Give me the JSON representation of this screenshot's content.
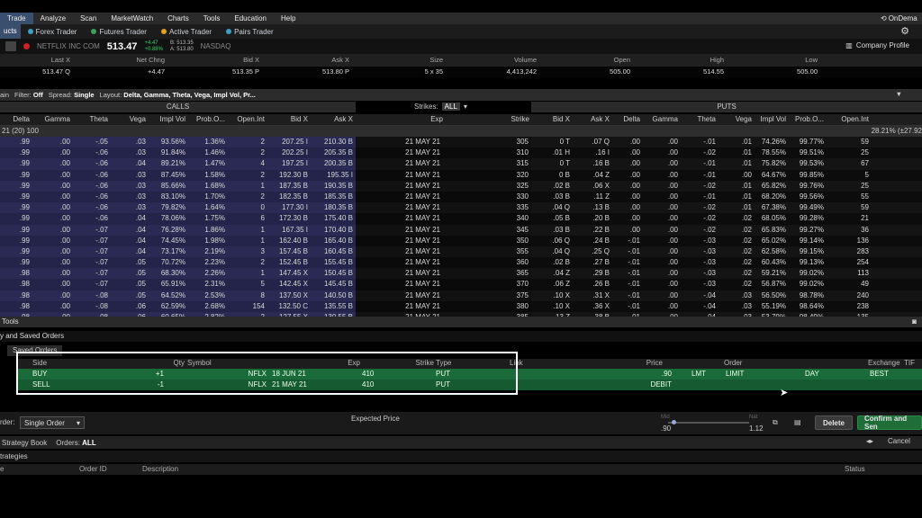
{
  "menu": [
    "Trade",
    "Analyze",
    "Scan",
    "MarketWatch",
    "Charts",
    "Tools",
    "Education",
    "Help"
  ],
  "menu_right": "OnDema",
  "toolbar": {
    "left_label": "ucts",
    "items": [
      {
        "label": "Forex Trader",
        "color": "#3aa0c9"
      },
      {
        "label": "Futures Trader",
        "color": "#3aa05a"
      },
      {
        "label": "Active Trader",
        "color": "#e0a020"
      },
      {
        "label": "Pairs Trader",
        "color": "#3aa0c9"
      }
    ]
  },
  "quote": {
    "name": "NETFLIX INC COM",
    "price": "513.47",
    "change": "+4.47",
    "change_pct": "+0.88%",
    "bid_line": "B: 513.35",
    "ask_line": "A: 513.80",
    "exchange": "NASDAQ",
    "profile": "Company Profile"
  },
  "summary": {
    "headers": [
      "Last X",
      "Net Chng",
      "Bid X",
      "Ask X",
      "Size",
      "Volume",
      "Open",
      "High",
      "Low"
    ],
    "values": [
      "513.47 Q",
      "+4.47",
      "513.35 P",
      "513.80 P",
      "5 x 35",
      "4,413,242",
      "505.00",
      "514.55",
      "505.00"
    ]
  },
  "chain_bar": {
    "prefix": "ain",
    "filter_label": "Filter:",
    "filter_value": "Off",
    "spread_label": "Spread:",
    "spread_value": "Single",
    "layout_label": "Layout:",
    "layout_value": "Delta, Gamma, Theta, Vega, Impl Vol, Pr..."
  },
  "calls_title": "CALLS",
  "puts_title": "PUTS",
  "strikes_label": "Strikes:",
  "strikes_value": "ALL",
  "call_cols": [
    "Delta",
    "Gamma",
    "Theta",
    "Vega",
    "Impl Vol",
    "Prob.O...",
    "Open.Int",
    "Bid X",
    "Ask X"
  ],
  "mid_cols": [
    "Exp",
    "Strike"
  ],
  "put_cols": [
    "Bid X",
    "Ask X",
    "Delta",
    "Gamma",
    "Theta",
    "Vega",
    "Impl Vol",
    "Prob.O...",
    "Open.Int"
  ],
  "group_row": {
    "left": "21   (20)   100",
    "right": "28.21% (±27.92"
  },
  "rows": [
    {
      "c": [
        ".99",
        ".00",
        "-.05",
        ".03",
        "93.56%",
        "1.36%",
        "2",
        "207.25  I",
        "210.30  B"
      ],
      "exp": "21 MAY 21",
      "strike": "305",
      "p": [
        "0  T",
        ".07  Q",
        ".00",
        ".00",
        "-.01",
        ".01",
        "74.26%",
        "99.77%",
        "59"
      ]
    },
    {
      "c": [
        ".99",
        ".00",
        "-.06",
        ".03",
        "91.84%",
        "1.46%",
        "2",
        "202.25  I",
        "205.35  B"
      ],
      "exp": "21 MAY 21",
      "strike": "310",
      "p": [
        ".01  H",
        ".16  I",
        ".00",
        ".00",
        "-.02",
        ".01",
        "78.55%",
        "99.51%",
        "25"
      ]
    },
    {
      "c": [
        ".99",
        ".00",
        "-.06",
        ".04",
        "89.21%",
        "1.47%",
        "4",
        "197.25  I",
        "200.35  B"
      ],
      "exp": "21 MAY 21",
      "strike": "315",
      "p": [
        "0  T",
        ".16  B",
        ".00",
        ".00",
        "-.01",
        ".01",
        "75.82%",
        "99.53%",
        "67"
      ]
    },
    {
      "c": [
        ".99",
        ".00",
        "-.06",
        ".03",
        "87.45%",
        "1.58%",
        "2",
        "192.30  B",
        "195.35  I"
      ],
      "exp": "21 MAY 21",
      "strike": "320",
      "p": [
        "0  B",
        ".04  Z",
        ".00",
        ".00",
        "-.01",
        ".00",
        "64.67%",
        "99.85%",
        "5"
      ]
    },
    {
      "c": [
        ".99",
        ".00",
        "-.06",
        ".03",
        "85.66%",
        "1.68%",
        "1",
        "187.35  B",
        "190.35  B"
      ],
      "exp": "21 MAY 21",
      "strike": "325",
      "p": [
        ".02  B",
        ".06  X",
        ".00",
        ".00",
        "-.02",
        ".01",
        "65.82%",
        "99.76%",
        "25"
      ]
    },
    {
      "c": [
        ".99",
        ".00",
        "-.06",
        ".03",
        "83.10%",
        "1.70%",
        "2",
        "182.35  B",
        "185.35  B"
      ],
      "exp": "21 MAY 21",
      "strike": "330",
      "p": [
        ".03  B",
        ".11  Z",
        ".00",
        ".00",
        "-.01",
        ".01",
        "68.20%",
        "99.56%",
        "55"
      ]
    },
    {
      "c": [
        ".99",
        ".00",
        "-.06",
        ".03",
        "79.82%",
        "1.64%",
        "0",
        "177.30  I",
        "180.35  B"
      ],
      "exp": "21 MAY 21",
      "strike": "335",
      "p": [
        ".04  Q",
        ".13  B",
        ".00",
        ".00",
        "-.02",
        ".01",
        "67.38%",
        "99.49%",
        "59"
      ]
    },
    {
      "c": [
        ".99",
        ".00",
        "-.06",
        ".04",
        "78.06%",
        "1.75%",
        "6",
        "172.30  B",
        "175.40  B"
      ],
      "exp": "21 MAY 21",
      "strike": "340",
      "p": [
        ".05  B",
        ".20  B",
        ".00",
        ".00",
        "-.02",
        ".02",
        "68.05%",
        "99.28%",
        "21"
      ]
    },
    {
      "c": [
        ".99",
        ".00",
        "-.07",
        ".04",
        "76.28%",
        "1.86%",
        "1",
        "167.35  I",
        "170.40  B"
      ],
      "exp": "21 MAY 21",
      "strike": "345",
      "p": [
        ".03  B",
        ".22  B",
        ".00",
        ".00",
        "-.02",
        ".02",
        "65.83%",
        "99.27%",
        "36"
      ]
    },
    {
      "c": [
        ".99",
        ".00",
        "-.07",
        ".04",
        "74.45%",
        "1.98%",
        "1",
        "162.40  B",
        "165.40  B"
      ],
      "exp": "21 MAY 21",
      "strike": "350",
      "p": [
        ".06  Q",
        ".24  B",
        "-.01",
        ".00",
        "-.03",
        ".02",
        "65.02%",
        "99.14%",
        "136"
      ]
    },
    {
      "c": [
        ".99",
        ".00",
        "-.07",
        ".04",
        "73.17%",
        "2.19%",
        "3",
        "157.45  B",
        "160.45  B"
      ],
      "exp": "21 MAY 21",
      "strike": "355",
      "p": [
        ".04  Q",
        ".25  Q",
        "-.01",
        ".00",
        "-.03",
        ".02",
        "62.58%",
        "99.15%",
        "283"
      ]
    },
    {
      "c": [
        ".99",
        ".00",
        "-.07",
        ".05",
        "70.72%",
        "2.23%",
        "2",
        "152.45  B",
        "155.45  B"
      ],
      "exp": "21 MAY 21",
      "strike": "360",
      "p": [
        ".02  B",
        ".27  B",
        "-.01",
        ".00",
        "-.03",
        ".02",
        "60.43%",
        "99.13%",
        "254"
      ]
    },
    {
      "c": [
        ".98",
        ".00",
        "-.07",
        ".05",
        "68.30%",
        "2.26%",
        "1",
        "147.45  X",
        "150.45  B"
      ],
      "exp": "21 MAY 21",
      "strike": "365",
      "p": [
        ".04  Z",
        ".29  B",
        "-.01",
        ".00",
        "-.03",
        ".02",
        "59.21%",
        "99.02%",
        "113"
      ]
    },
    {
      "c": [
        ".98",
        ".00",
        "-.07",
        ".05",
        "65.91%",
        "2.31%",
        "5",
        "142.45  X",
        "145.45  B"
      ],
      "exp": "21 MAY 21",
      "strike": "370",
      "p": [
        ".06  Z",
        ".26  B",
        "-.01",
        ".00",
        "-.03",
        ".02",
        "56.87%",
        "99.02%",
        "49"
      ]
    },
    {
      "c": [
        ".98",
        ".00",
        "-.08",
        ".05",
        "64.52%",
        "2.53%",
        "8",
        "137.50  X",
        "140.50  B"
      ],
      "exp": "21 MAY 21",
      "strike": "375",
      "p": [
        ".10  X",
        ".31  X",
        "-.01",
        ".00",
        "-.04",
        ".03",
        "56.50%",
        "98.78%",
        "240"
      ]
    },
    {
      "c": [
        ".98",
        ".00",
        "-.08",
        ".06",
        "62.59%",
        "2.68%",
        "154",
        "132.50  C",
        "135.55  B"
      ],
      "exp": "21 MAY 21",
      "strike": "380",
      "p": [
        ".10  X",
        ".36  X",
        "-.01",
        ".00",
        "-.04",
        ".03",
        "55.19%",
        "98.64%",
        "238"
      ]
    },
    {
      "c": [
        ".98",
        ".00",
        "-.08",
        ".06",
        "60.65%",
        "2.82%",
        "2",
        "127.55  X",
        "130.55  B"
      ],
      "exp": "21 MAY 21",
      "strike": "385",
      "p": [
        ".13  Z",
        ".38  B",
        "-.01",
        ".00",
        "-.04",
        ".03",
        "53.79%",
        "98.49%",
        "135"
      ]
    }
  ],
  "tools_label": "Tools",
  "saved_orders_label": "y and Saved Orders",
  "saved_tab": "Saved Orders",
  "order_cols": [
    "Side",
    "Qty",
    "Symbol",
    "Exp",
    "Strike",
    "Type",
    "Link",
    "Price",
    "Order",
    "TIF",
    "Exchange"
  ],
  "orders": [
    {
      "side": "BUY",
      "qty": "+1",
      "symbol": "NFLX",
      "exp": "18 JUN 21",
      "strike": "410",
      "type": "PUT",
      "price": ".90",
      "lmt": "LMT",
      "order": "LIMIT",
      "tif": "DAY",
      "exch": "BEST"
    },
    {
      "side": "SELL",
      "qty": "-1",
      "symbol": "NFLX",
      "exp": "21 MAY 21",
      "strike": "410",
      "type": "PUT",
      "price": "DEBIT",
      "lmt": "",
      "order": "",
      "tif": "",
      "exch": ""
    }
  ],
  "bottom": {
    "order_label": "rder:",
    "order_value": "Single Order",
    "expected": "Expected  Price",
    "mid_label": "Mid",
    "nat_label": "Nat",
    "mid_val": ".90",
    "nat_val": "1.12",
    "delete": "Delete",
    "confirm": "Confirm and Sen"
  },
  "book": {
    "label": "Strategy Book",
    "orders_label": "Orders:",
    "orders_value": "ALL",
    "cancel": "Cancel"
  },
  "strategies_label": "trategies",
  "bottom_cols": [
    "e",
    "Order ID",
    "Description",
    "Status"
  ],
  "colors": {
    "green": "#2bd46a",
    "calls_bg": "#2a2a55",
    "order_green": "#1b6b3a"
  }
}
